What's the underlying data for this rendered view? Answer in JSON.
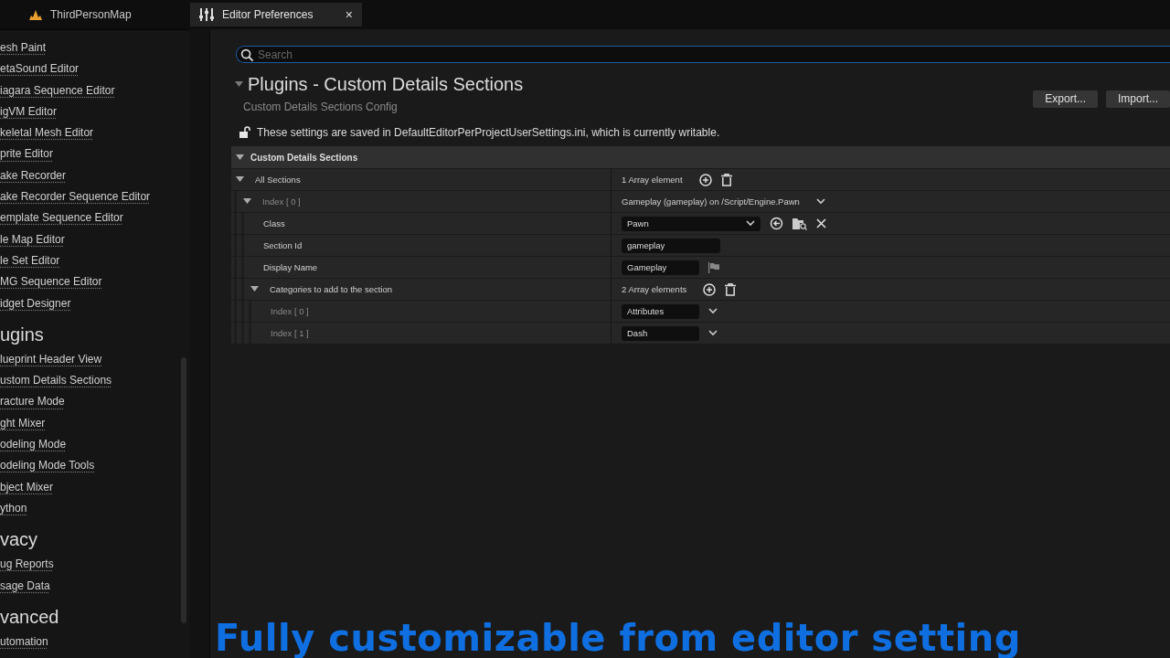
{
  "tabs": [
    {
      "label": "ThirdPersonMap",
      "selected": false
    },
    {
      "label": "Editor Preferences",
      "selected": true,
      "close": "×"
    }
  ],
  "sidebar": {
    "groups": [
      {
        "items": [
          "esh Paint",
          "etaSound Editor",
          "iagara Sequence Editor",
          "igVM Editor",
          "keletal Mesh Editor",
          "prite Editor",
          "ake Recorder",
          "ake Recorder Sequence Editor",
          "emplate Sequence Editor",
          "le Map Editor",
          "le Set Editor",
          "MG Sequence Editor",
          "idget Designer"
        ]
      },
      {
        "heading": "ugins",
        "items": [
          "lueprint Header View",
          "ustom Details Sections",
          "racture Mode",
          "ght Mixer",
          "odeling Mode",
          "odeling Mode Tools",
          "bject Mixer",
          "ython"
        ]
      },
      {
        "heading": "vacy",
        "items": [
          "ug Reports",
          "sage Data"
        ]
      },
      {
        "heading": "vanced",
        "items": [
          "utomation"
        ]
      }
    ]
  },
  "search": {
    "placeholder": "Search"
  },
  "section": {
    "title": "Plugins - Custom Details Sections",
    "expanded": true,
    "subtitle": "Custom Details Sections Config",
    "buttons": [
      "Export...",
      "Import..."
    ],
    "notice": "These settings are saved in DefaultEditorPerProjectUserSettings.ini, which is currently writable."
  },
  "details": {
    "category": "Custom Details Sections",
    "expanded": true,
    "rows": [
      {
        "label": "All Sections",
        "expanded": true,
        "value": {
          "kind": "array",
          "text": "1 Array element"
        },
        "children": [
          {
            "label": "Index [ 0 ]",
            "dim": true,
            "expanded": true,
            "value": {
              "kind": "summary",
              "text": "Gameplay (gameplay) on /Script/Engine.Pawn"
            },
            "children": [
              {
                "label": "Class",
                "value": {
                  "kind": "class",
                  "text": "Pawn"
                }
              },
              {
                "label": "Section Id",
                "value": {
                  "kind": "field",
                  "text": "gameplay"
                }
              },
              {
                "label": "Display Name",
                "value": {
                  "kind": "localized",
                  "text": "Gameplay"
                }
              },
              {
                "label": "Categories to add to the section",
                "expanded": true,
                "value": {
                  "kind": "array",
                  "text": "2 Array elements"
                },
                "children": [
                  {
                    "label": "Index [ 0 ]",
                    "dim": true,
                    "value": {
                      "kind": "combo",
                      "text": "Attributes"
                    }
                  },
                  {
                    "label": "Index [ 1 ]",
                    "dim": true,
                    "value": {
                      "kind": "combo",
                      "text": "Dash"
                    }
                  }
                ]
              }
            ]
          }
        ]
      }
    ]
  },
  "caption": "Fully customizable from editor setting"
}
